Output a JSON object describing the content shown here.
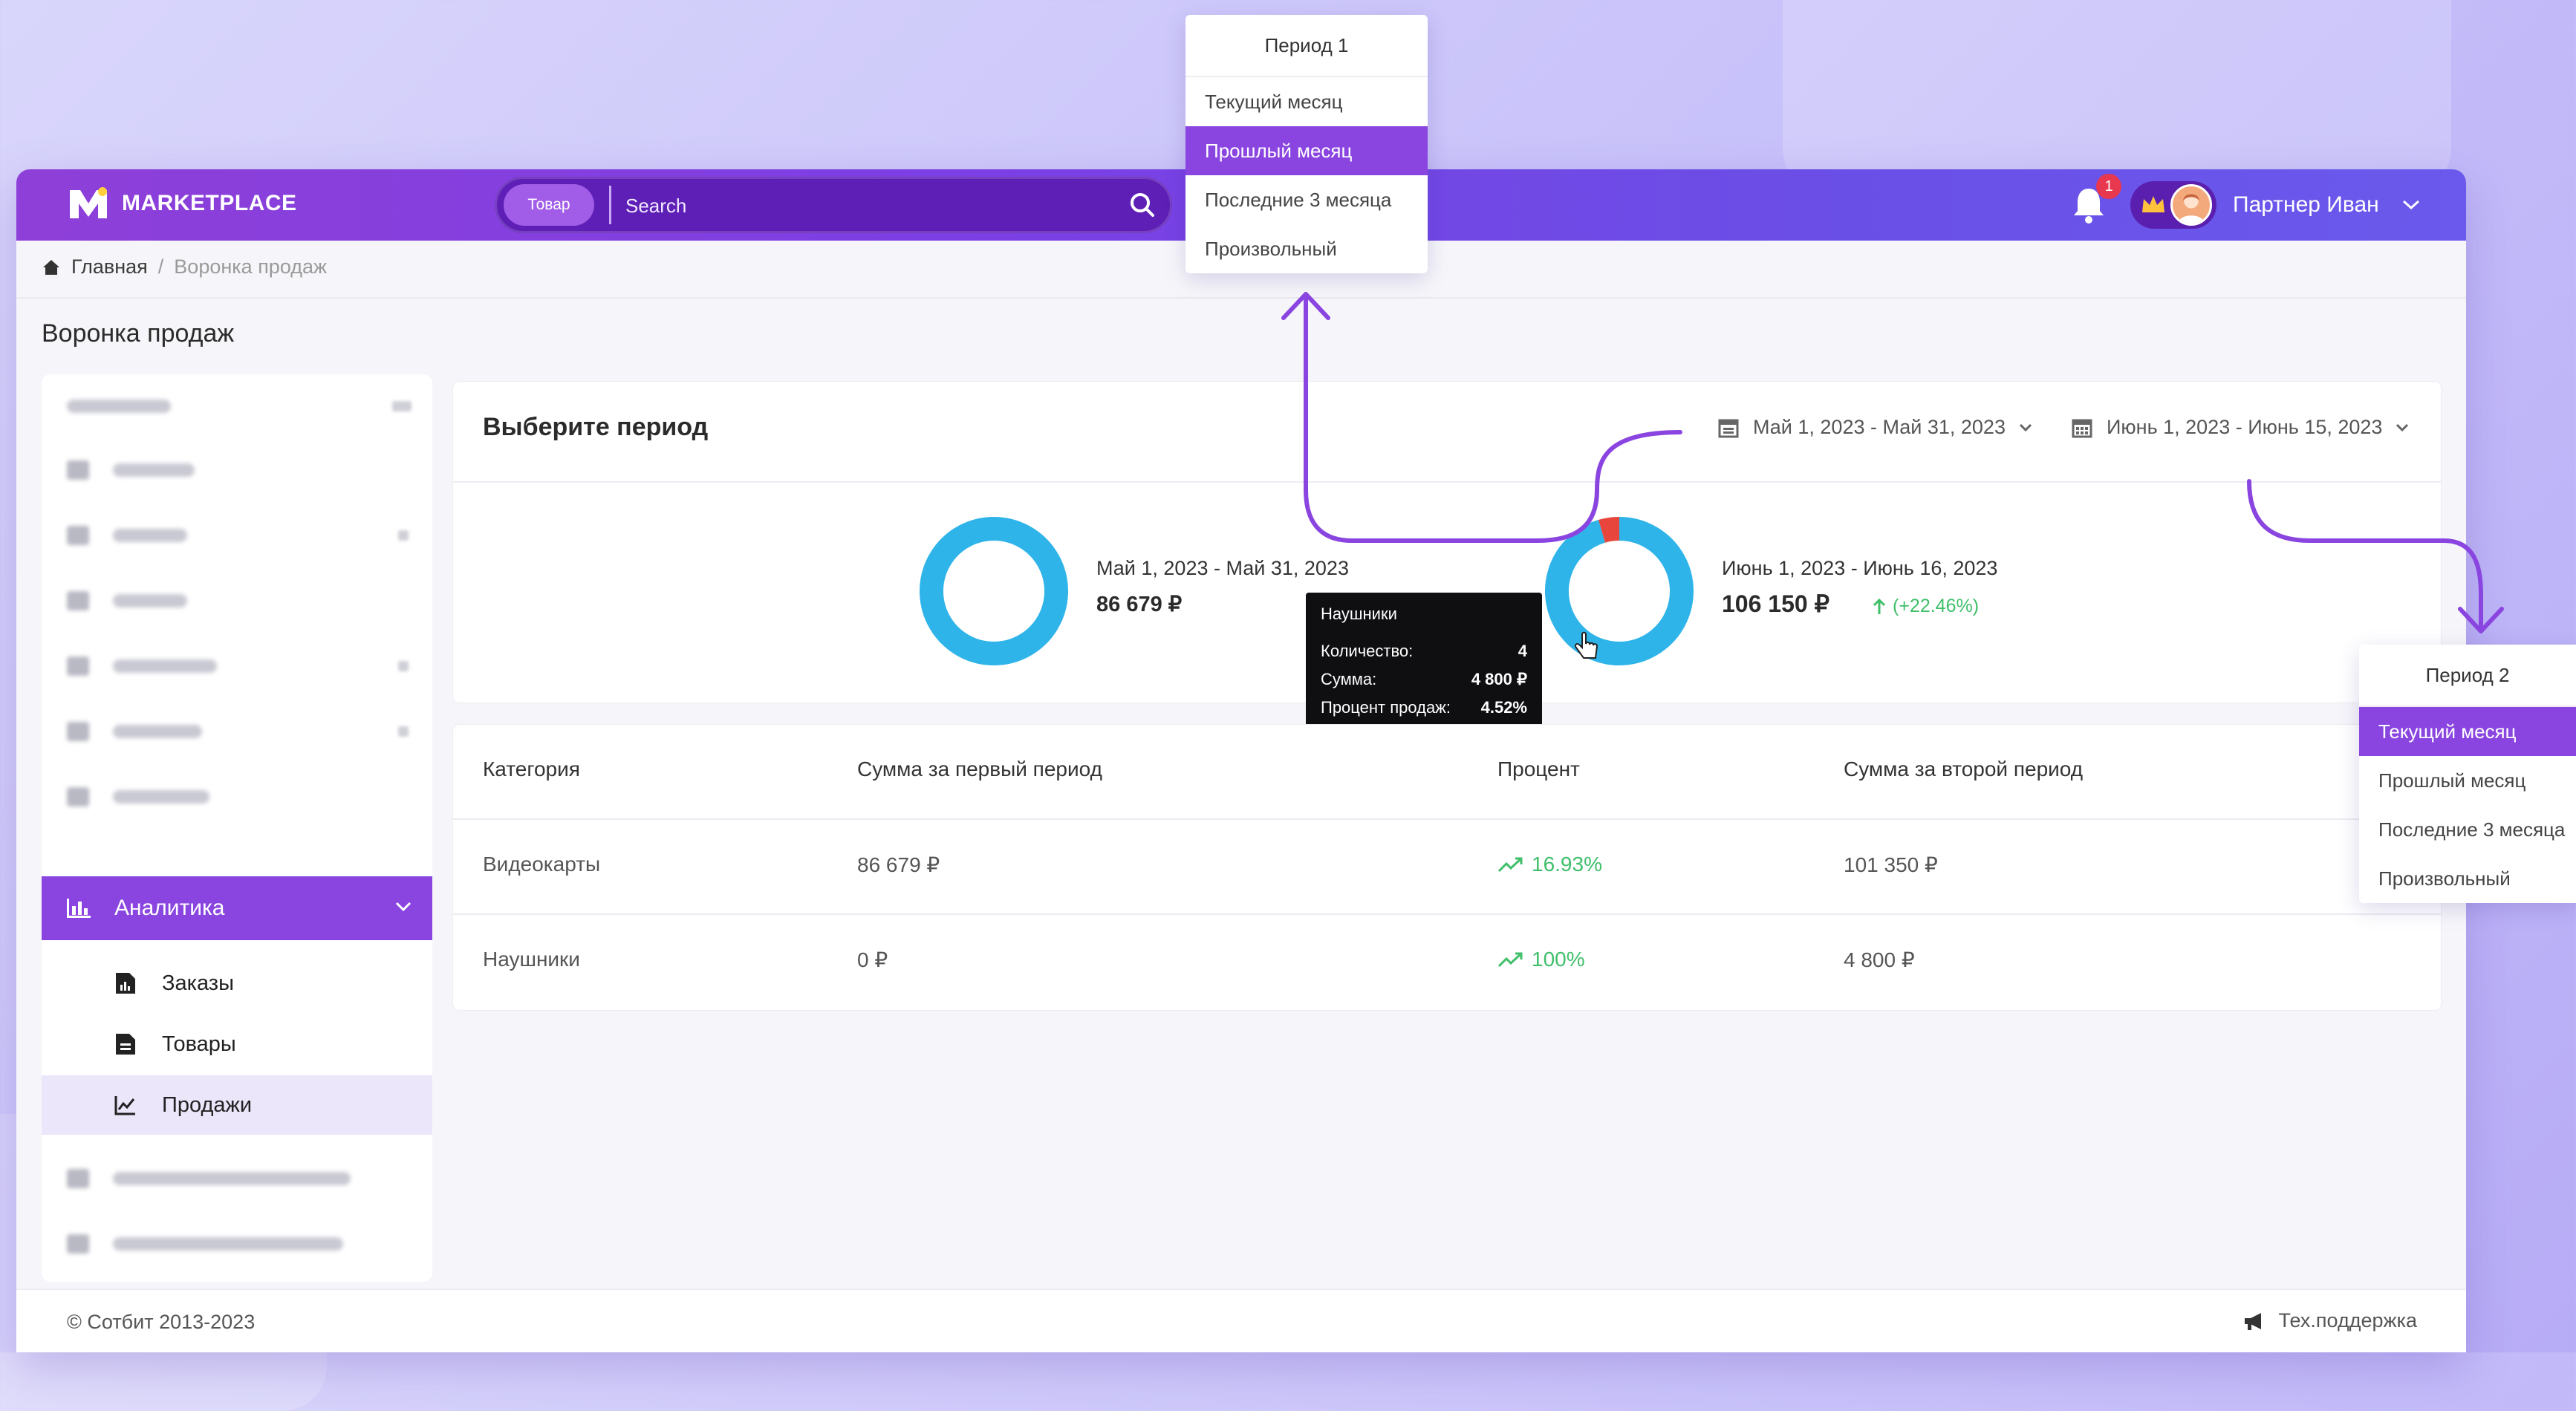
{
  "header": {
    "logo_text": "MARKETPLACE",
    "search_chip": "Товар",
    "search_placeholder": "Search",
    "notifications_count": "1",
    "user_name": "Партнер Иван"
  },
  "breadcrumb": {
    "home": "Главная",
    "separator": "/",
    "current": "Воронка продаж"
  },
  "page": {
    "title": "Воронка продаж"
  },
  "sidebar": {
    "active_section": "Аналитика",
    "subitems": [
      {
        "label": "Заказы",
        "icon": "document-chart-icon"
      },
      {
        "label": "Товары",
        "icon": "document-list-icon"
      },
      {
        "label": "Продажи",
        "icon": "line-chart-icon",
        "current": true
      }
    ]
  },
  "period_card": {
    "title": "Выберите период",
    "period1_range": "Май 1, 2023 - Май 31, 2023",
    "period2_range": "Июнь 1, 2023 - Июнь 15, 2023",
    "donut1": {
      "label": "Май 1, 2023 - Май 31, 2023",
      "value": "86 679 ₽",
      "segments": [
        1.0
      ]
    },
    "donut2": {
      "label": "Июнь 1, 2023 - Июнь 16, 2023",
      "value": "106 150 ₽",
      "delta": "(+22.46%)",
      "segments": [
        0.9548,
        0.0452
      ]
    }
  },
  "tooltip": {
    "title": "Наушники",
    "rows": [
      {
        "label": "Количество:",
        "value": "4"
      },
      {
        "label": "Сумма:",
        "value": "4 800 ₽"
      },
      {
        "label": "Процент продаж:",
        "value": "4.52%"
      }
    ]
  },
  "table": {
    "headers": [
      "Категория",
      "Сумма за первый период",
      "Процент",
      "Сумма за второй период"
    ],
    "rows": [
      {
        "category": "Видеокарты",
        "sum1": "86 679 ₽",
        "percent": "16.93%",
        "sum2": "101 350 ₽"
      },
      {
        "category": "Наушники",
        "sum1": "0 ₽",
        "percent": "100%",
        "sum2": "4 800 ₽"
      }
    ]
  },
  "footer": {
    "copyright": "© Сотбит 2013-2023",
    "support": "Тех.поддержка"
  },
  "dropdown_period1": {
    "title": "Период 1",
    "options": [
      "Текущий месяц",
      "Прошлый месяц",
      "Последние 3 месяца",
      "Произвольный"
    ],
    "selected_index": 1
  },
  "dropdown_period2": {
    "title": "Период 2",
    "options": [
      "Текущий месяц",
      "Прошлый месяц",
      "Последние 3 месяца",
      "Произвольный"
    ],
    "selected_index": 0
  },
  "colors": {
    "accent": "#8a45e0",
    "donut_main": "#2fb4ea",
    "donut_highlight": "#e8453c",
    "positive": "#3fbf6a",
    "annotation_arrow": "#8a45e0"
  }
}
